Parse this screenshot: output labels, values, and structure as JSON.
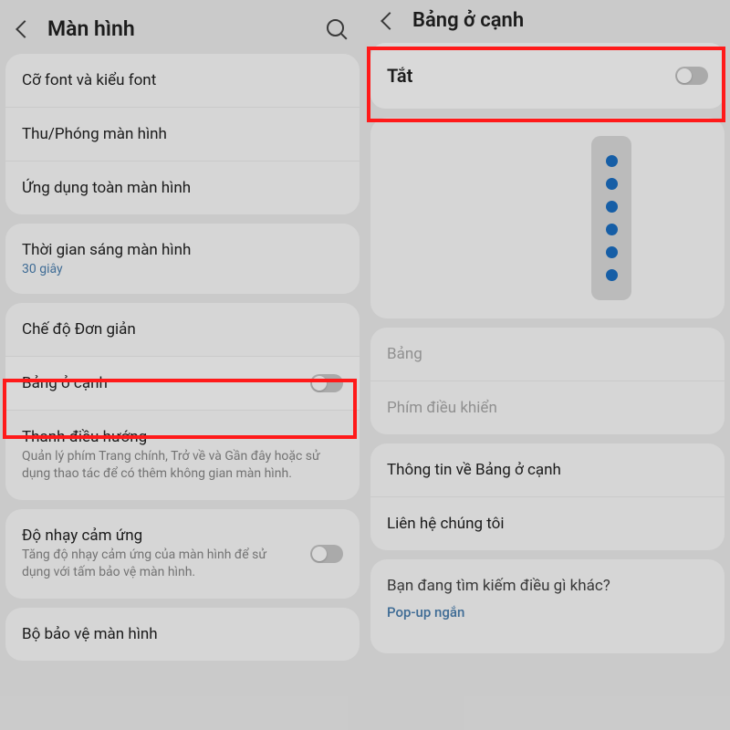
{
  "left": {
    "header_title": "Màn hình",
    "items": {
      "font": "Cỡ font và kiểu font",
      "zoom": "Thu/Phóng màn hình",
      "fullscreen": "Ứng dụng toàn màn hình",
      "timeout": "Thời gian sáng màn hình",
      "timeout_value": "30 giây",
      "simple": "Chế độ Đơn giản",
      "edge_panel": "Bảng ở cạnh",
      "navbar": "Thanh điều hướng",
      "navbar_sub": "Quản lý phím Trang chính, Trở về và Gần đây hoặc sử dụng thao tác để có thêm không gian màn hình.",
      "touch": "Độ nhạy cảm ứng",
      "touch_sub": "Tăng độ nhạy cảm ứng của màn hình để sử dụng với tấm bảo vệ màn hình.",
      "screensaver": "Bộ bảo vệ màn hình"
    }
  },
  "right": {
    "header_title": "Bảng ở cạnh",
    "toggle_label": "Tắt",
    "items": {
      "panel": "Bảng",
      "handle": "Phím điều khiển",
      "about": "Thông tin về Bảng ở cạnh",
      "contact": "Liên hệ chúng tôi"
    },
    "search_other_title": "Bạn đang tìm kiếm điều gì khác?",
    "search_other_link": "Pop-up ngắn"
  }
}
